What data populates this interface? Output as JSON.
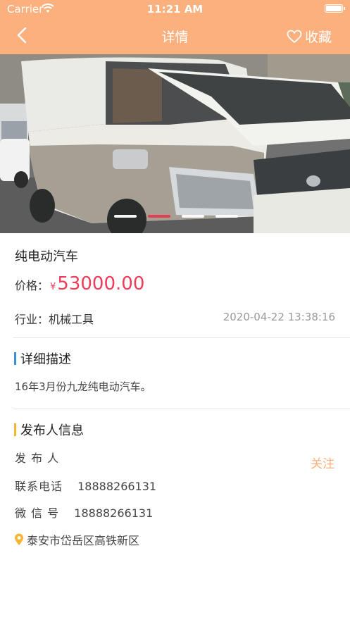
{
  "status_bar": {
    "carrier": "Carrier",
    "time": "11:21 AM"
  },
  "nav": {
    "title": "详情",
    "favorite_label": "收藏"
  },
  "colors": {
    "header": "#fbb07e",
    "price": "#f03c58",
    "accent_blue": "#3a8fd9",
    "accent_orange": "#f6b433",
    "follow": "#fbb07e"
  },
  "banner": {
    "image_description": "white and champagne electric van",
    "slides": 4,
    "active_slide": 2
  },
  "product": {
    "title": "纯电动汽车",
    "price_label": "价格：",
    "currency": "¥",
    "price": "53000.00",
    "industry_label": "行业：",
    "industry": "机械工具",
    "date": "2020-04-22 13:38:16"
  },
  "description": {
    "heading": "详细描述",
    "text": "16年3月份九龙纯电动汽车。"
  },
  "publisher": {
    "heading": "发布人信息",
    "name_label": "发 布 人",
    "follow_label": "关注",
    "phone_label": "联系电话",
    "phone": "18888266131",
    "wechat_label": "微 信 号",
    "wechat": "18888266131",
    "address": "泰安市岱岳区高铁新区"
  }
}
